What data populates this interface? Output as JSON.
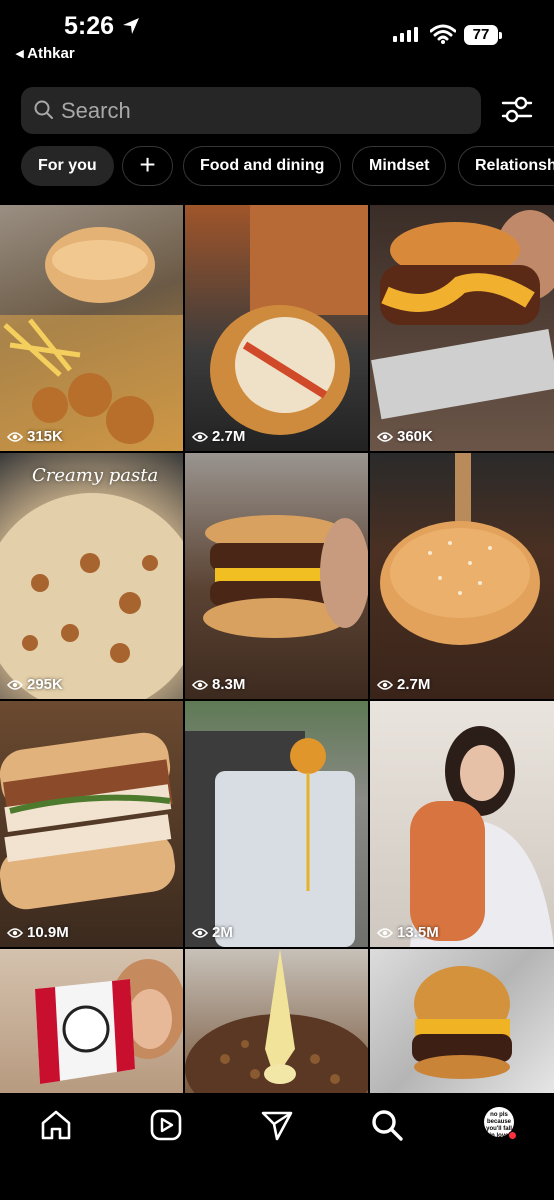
{
  "status_bar": {
    "time": "5:26",
    "back_app": "Athkar",
    "battery": "77"
  },
  "search": {
    "placeholder": "Search"
  },
  "chips": [
    {
      "label": "For you",
      "active": true
    },
    {
      "label": "+",
      "active": false
    },
    {
      "label": "Food and dining",
      "active": false
    },
    {
      "label": "Mindset",
      "active": false
    },
    {
      "label": "Relationships",
      "active": false
    }
  ],
  "grid": [
    {
      "views": "315K",
      "subject": "sandwich with fries and nuggets"
    },
    {
      "views": "2.7M",
      "subject": "stuffed sub sandwich"
    },
    {
      "views": "360K",
      "subject": "cheeseburger with sauce"
    },
    {
      "views": "295K",
      "subject": "creamy pasta",
      "caption": "Creamy pasta"
    },
    {
      "views": "8.3M",
      "subject": "double cheeseburger"
    },
    {
      "views": "2.7M",
      "subject": "sesame bun"
    },
    {
      "views": "10.9M",
      "subject": "chicken sandwich"
    },
    {
      "views": "2M",
      "subject": "pouring syrup"
    },
    {
      "views": "13.5M",
      "subject": "woman holding roll"
    },
    {
      "views": "",
      "subject": "KFC bucket"
    },
    {
      "views": "",
      "subject": "piping cheese"
    },
    {
      "views": "",
      "subject": "burger on foil"
    }
  ],
  "nav": {
    "avatar_text": "no pls because you'll fall in love"
  },
  "colors": {
    "background": "#000000",
    "search_bg": "#262626",
    "notification_dot": "#ff3040"
  }
}
